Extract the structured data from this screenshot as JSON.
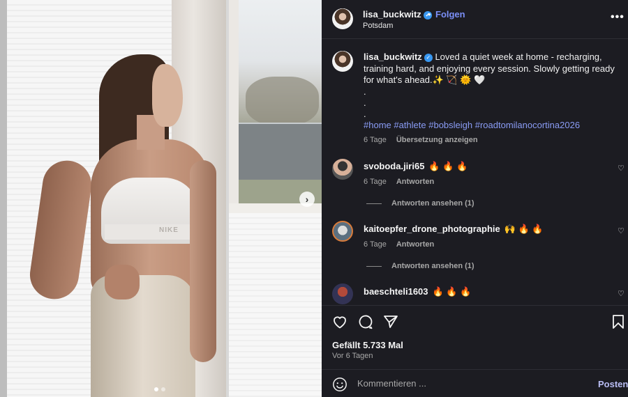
{
  "media": {
    "brand_text": "NIKE",
    "next_glyph": "›",
    "slide_count": 2,
    "active_slide": 1
  },
  "header": {
    "username": "lisa_buckwitz",
    "bullet": "•",
    "follow_label": "Folgen",
    "location": "Potsdam",
    "more_glyph": "•••"
  },
  "caption": {
    "username": "lisa_buckwitz",
    "text": "Loved a quiet week at home - recharging, training hard, and enjoying every session. Slowly getting ready for what's ahead.✨ 🏹 🌞 🤍",
    "dot_lines": [
      ".",
      ".",
      "."
    ],
    "hashtags": "#home #athlete #bobsleigh #roadtomilanocortina2026",
    "time": "6 Tage",
    "translate_label": "Übersetzung anzeigen"
  },
  "comments": [
    {
      "username": "svoboda.jiri65",
      "text": "🔥 🔥 🔥",
      "time": "6 Tage",
      "reply_label": "Antworten",
      "view_replies": "Antworten ansehen (1)"
    },
    {
      "username": "kaitoepfer_drone_photographie",
      "text": "🙌 🔥 🔥",
      "time": "6 Tage",
      "reply_label": "Antworten",
      "view_replies": "Antworten ansehen (1)"
    },
    {
      "username": "baeschteli1603",
      "text": "🔥 🔥 🔥"
    }
  ],
  "heart_glyph": "♡",
  "engagement": {
    "likes": "Gefällt 5.733 Mal",
    "posted": "Vor 6 Tagen"
  },
  "comment_box": {
    "placeholder": "Kommentieren ...",
    "post_label": "Posten"
  },
  "colors": {
    "panel_bg": "#1c1c22",
    "link_blue": "#7b8ff7",
    "hashtag_blue": "#8a9cf5",
    "verified_blue": "#3897f0"
  }
}
